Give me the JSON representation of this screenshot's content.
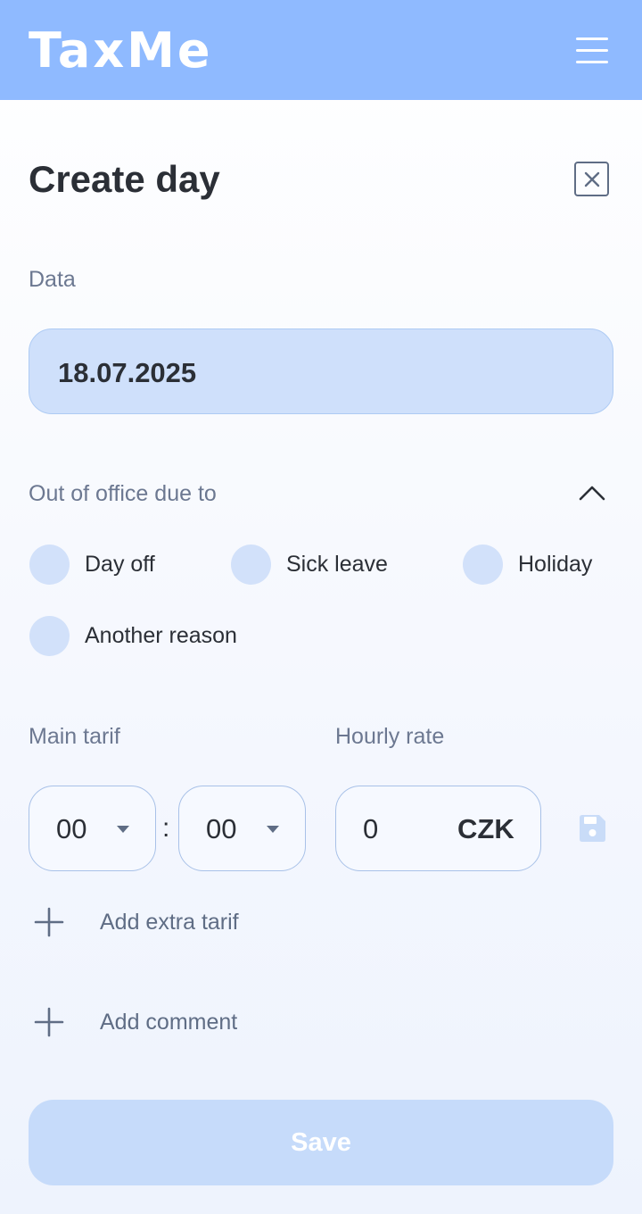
{
  "header": {
    "app_title": "TaxMe",
    "menu_icon": "hamburger-menu-icon"
  },
  "page": {
    "title": "Create day",
    "close_icon": "close-icon"
  },
  "date_section": {
    "label": "Data",
    "value": "18.07.2025"
  },
  "out_of_office": {
    "label": "Out of office due to",
    "toggle_icon": "chevron-up-icon",
    "options": [
      {
        "label": "Day off",
        "selected": false
      },
      {
        "label": "Sick leave",
        "selected": false
      },
      {
        "label": "Holiday",
        "selected": false
      },
      {
        "label": "Another reason",
        "selected": false
      }
    ]
  },
  "tarif": {
    "main_label": "Main tarif",
    "hours": "00",
    "minutes": "00",
    "separator": ":",
    "hourly_label": "Hourly rate",
    "rate_value": "0",
    "currency": "CZK",
    "save_icon": "floppy-disk-icon"
  },
  "actions": {
    "add_extra_tarif": "Add extra tarif",
    "add_comment": "Add comment",
    "plus_icon": "plus-icon"
  },
  "save_button": {
    "label": "Save",
    "disabled": true
  },
  "colors": {
    "header_bg": "#8fbaff",
    "field_bg": "#cfe0fb",
    "radio_bg": "#d2e1fa",
    "save_bg_disabled": "#c6dbfa",
    "text_primary": "#2b2f36",
    "text_muted": "#6c7891"
  }
}
